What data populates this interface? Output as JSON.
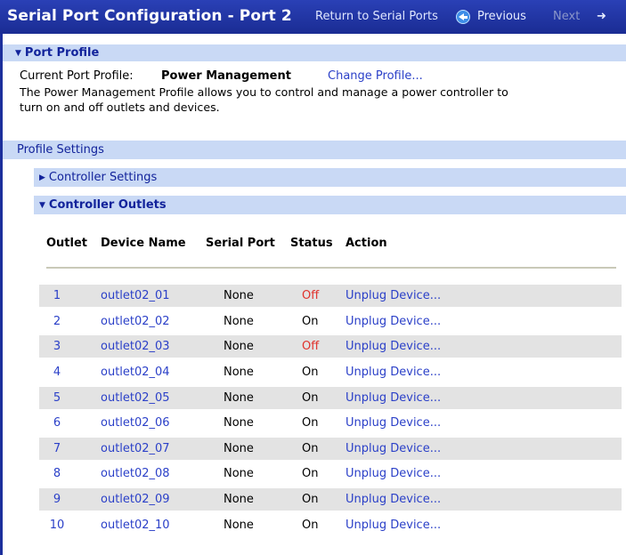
{
  "header": {
    "title": "Serial Port Configuration - Port 2",
    "return_link": "Return to Serial Ports",
    "previous": "Previous",
    "next": "Next"
  },
  "port_profile": {
    "section_title": "Port Profile",
    "current_label": "Current Port Profile:",
    "current_value": "Power Management",
    "change_link": "Change Profile...",
    "description_line1": "The Power Management Profile allows you to control and manage a power controller to",
    "description_line2": "turn on and off outlets and devices."
  },
  "profile_settings": {
    "title": "Profile Settings",
    "controller_settings": "Controller Settings",
    "controller_outlets": "Controller Outlets"
  },
  "outlets_table": {
    "headers": [
      "Outlet",
      "Device Name",
      "Serial Port",
      "Status",
      "Action"
    ],
    "rows": [
      {
        "outlet": "1",
        "device": "outlet02_01",
        "serial": "None",
        "status": "Off",
        "action": "Unplug Device..."
      },
      {
        "outlet": "2",
        "device": "outlet02_02",
        "serial": "None",
        "status": "On",
        "action": "Unplug Device..."
      },
      {
        "outlet": "3",
        "device": "outlet02_03",
        "serial": "None",
        "status": "Off",
        "action": "Unplug Device..."
      },
      {
        "outlet": "4",
        "device": "outlet02_04",
        "serial": "None",
        "status": "On",
        "action": "Unplug Device..."
      },
      {
        "outlet": "5",
        "device": "outlet02_05",
        "serial": "None",
        "status": "On",
        "action": "Unplug Device..."
      },
      {
        "outlet": "6",
        "device": "outlet02_06",
        "serial": "None",
        "status": "On",
        "action": "Unplug Device..."
      },
      {
        "outlet": "7",
        "device": "outlet02_07",
        "serial": "None",
        "status": "On",
        "action": "Unplug Device..."
      },
      {
        "outlet": "8",
        "device": "outlet02_08",
        "serial": "None",
        "status": "On",
        "action": "Unplug Device..."
      },
      {
        "outlet": "9",
        "device": "outlet02_09",
        "serial": "None",
        "status": "On",
        "action": "Unplug Device..."
      },
      {
        "outlet": "10",
        "device": "outlet02_10",
        "serial": "None",
        "status": "On",
        "action": "Unplug Device..."
      }
    ]
  },
  "colors": {
    "title_bar": "#1a2c93",
    "section_bar": "#c9d9f5",
    "link": "#2b40c8",
    "status_off": "#e0322c",
    "row_shade": "#e3e3e3"
  }
}
